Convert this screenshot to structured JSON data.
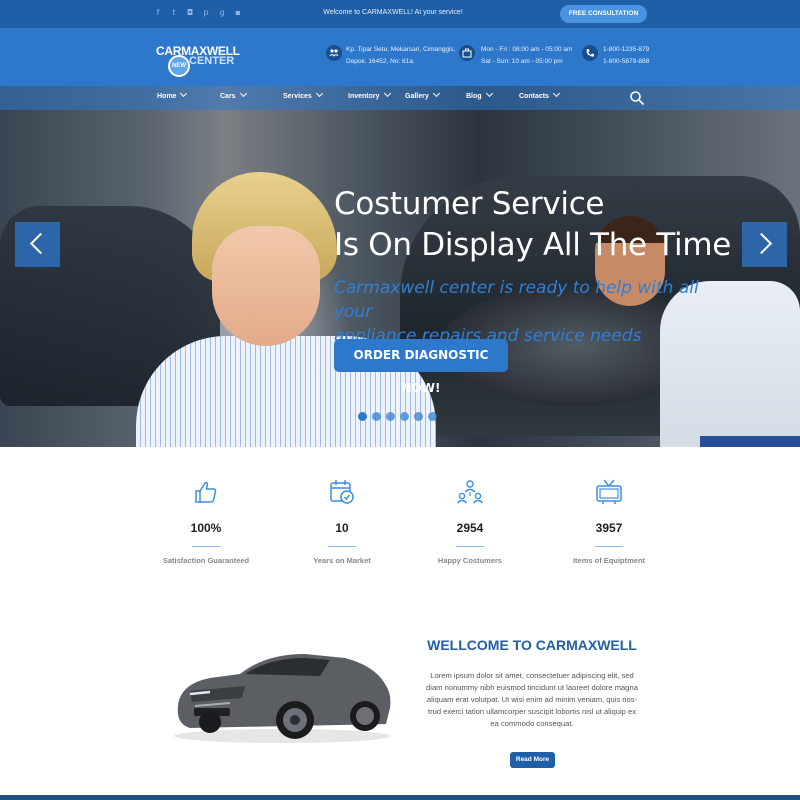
{
  "topbar": {
    "social_icons": [
      "facebook-icon",
      "twitter-icon",
      "instagram-icon",
      "pinterest-icon",
      "google-plus-icon",
      "youtube-icon"
    ],
    "welcome_text": "Welcome to CARMAXWELL! At your service!",
    "consult_label": "FREE CONSULTATION"
  },
  "header": {
    "logo_top": "CARMAXWELL",
    "logo_badge": "NEW",
    "logo_bottom": "CENTER",
    "address_line1": "Kp. Tipar Setu, Mekarsari, Cimanggis,",
    "address_line2": "Depok. 16452, No: 61a.",
    "hours_line1": "Mon - Fri : 08:00 am - 05:00 am",
    "hours_line2": "Sat - Sun: 10 am - 05:00 pm",
    "phone_line1": "1-800-1235-879",
    "phone_line2": "1-800-5879-888"
  },
  "nav": {
    "items": [
      "Home",
      "Cars",
      "Services",
      "Inventory",
      "Gallery",
      "Blog",
      "Contacts"
    ]
  },
  "hero": {
    "title_line1": "Costumer Service",
    "title_line2": "Is On Display All The Time",
    "subtitle_line1": "Carmaxwell center is ready to help with all your",
    "subtitle_line2": "appliance repairs and service needs",
    "button_label": "ORDER DIAGNOSTIC NOW!",
    "slides": 6,
    "active_slide": 1
  },
  "stats": [
    {
      "icon": "thumbs-up-icon",
      "value": "100%",
      "label": "Satisfaction Guaranteed"
    },
    {
      "icon": "calendar-icon",
      "value": "10",
      "label": "Years on Market"
    },
    {
      "icon": "people-icon",
      "value": "2954",
      "label": "Happy Costumers"
    },
    {
      "icon": "tv-icon",
      "value": "3957",
      "label": "Items of Equiptment"
    }
  ],
  "welcome": {
    "title": "WELLCOME TO CARMAXWELL",
    "text_lines": [
      "Lorem ipsum dolor sit amet, consectetuer adipiscing elit, sed",
      "diam nonummy nibh euismod tincidunt ut laoreet dolore magna",
      "aliquam erat volutpat. Ut wisi enim ad minim veniam, quis nos-",
      "trud exerci tation ullamcorper suscipit lobortis nisl ut aliquip ex",
      "ea commodo consequat."
    ],
    "button_label": "Read More"
  },
  "colors": {
    "primary": "#2e78cc",
    "dark": "#1f5fa8",
    "accent_text": "#2f7fd6"
  }
}
